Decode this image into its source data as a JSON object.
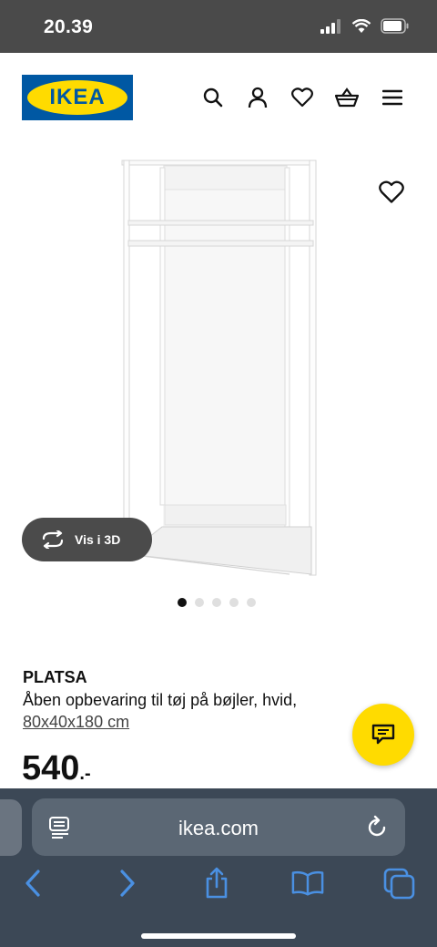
{
  "status_bar": {
    "time": "20.39"
  },
  "header": {
    "logo_text": "IKEA"
  },
  "gallery": {
    "view_3d_label": "Vis i 3D",
    "active_index": 0,
    "total_images": 5
  },
  "product": {
    "name": "PLATSA",
    "description": "Åben opbevaring til tøj på bøjler, hvid,",
    "size": "80x40x180 cm",
    "price_main": "540",
    "price_suffix": ".-"
  },
  "browser": {
    "url": "ikea.com"
  },
  "colors": {
    "brand_blue": "#0058a3",
    "brand_yellow": "#ffdb00",
    "browser_bg": "#3c4856",
    "link_blue": "#4a90e2"
  }
}
